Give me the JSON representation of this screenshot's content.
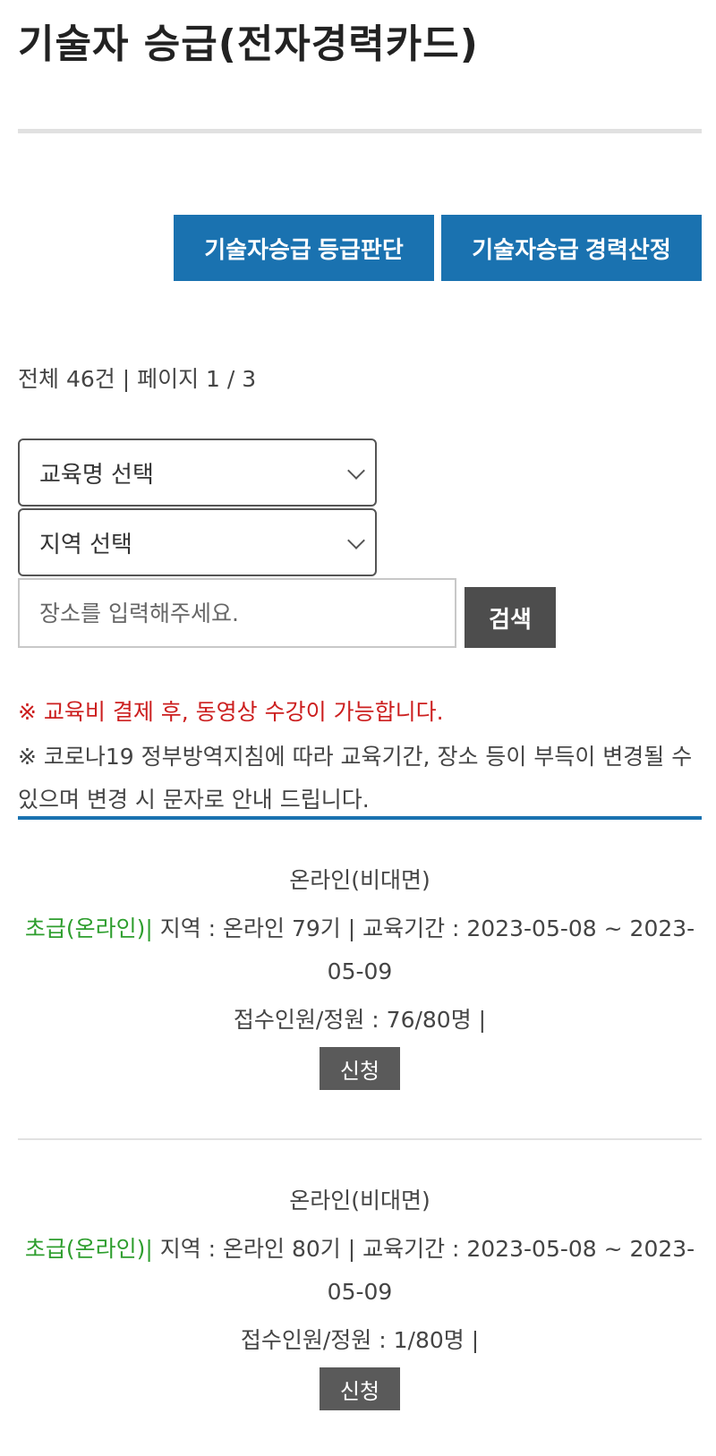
{
  "page_title": "기술자 승급(전자경력카드)",
  "buttons": {
    "grade_label": "기술자승급 등급판단",
    "career_label": "기술자승급 경력산정"
  },
  "summary": "전체 46건 | 페이지 1 / 3",
  "filters": {
    "education_select": "교육명 선택",
    "region_select": "지역 선택",
    "place_placeholder": "장소를 입력해주세요.",
    "search_label": "검색"
  },
  "notices": {
    "red": "※ 교육비 결제 후, 동영상 수강이 가능합니다.",
    "gray": "※ 코로나19 정부방역지침에 따라 교육기간, 장소 등이 부득이 변경될 수 있으며 변경 시 문자로 안내 드립니다."
  },
  "courses": [
    {
      "type": "온라인(비대면)",
      "level": "초급(온라인)|",
      "info": " 지역 : 온라인 79기 | 교육기간 : 2023-05-08 ~ 2023-05-09",
      "count": "접수인원/정원 : 76/80명 |",
      "apply_label": "신청"
    },
    {
      "type": "온라인(비대면)",
      "level": "초급(온라인)|",
      "info": " 지역 : 온라인 80기 | 교육기간 : 2023-05-08 ~ 2023-05-09",
      "count": "접수인원/정원 : 1/80명 |",
      "apply_label": "신청"
    }
  ],
  "colors": {
    "accent_blue": "#1a72b0",
    "notice_red": "#cc1f1f",
    "level_green": "#2e9e2e",
    "dark_button": "#4d4d4d"
  }
}
